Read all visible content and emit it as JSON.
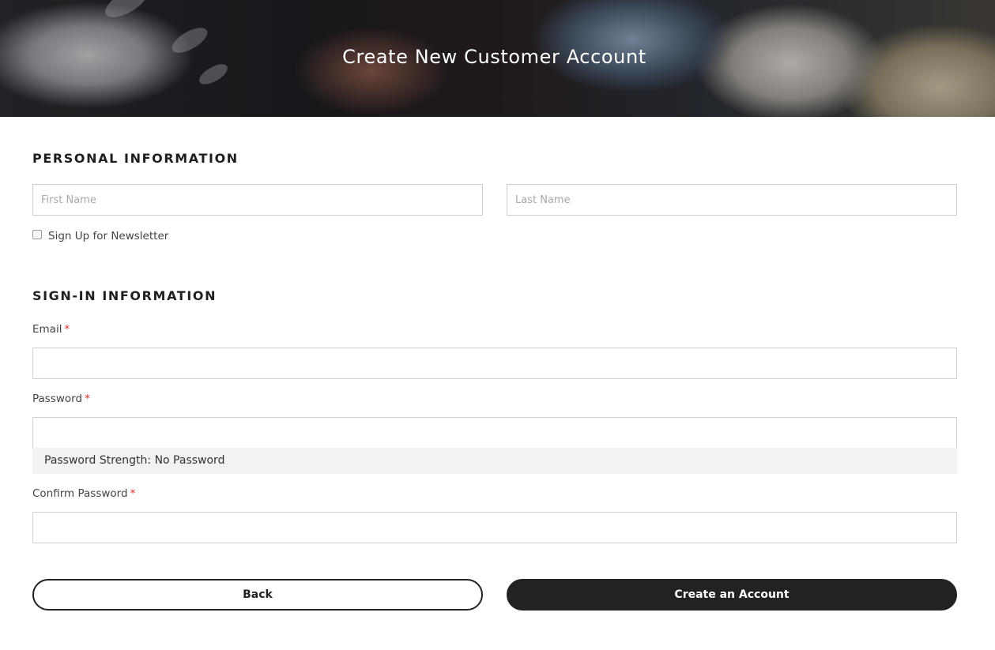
{
  "hero": {
    "title": "Create New Customer Account"
  },
  "personal": {
    "heading": "PERSONAL INFORMATION",
    "first_name_placeholder": "First Name",
    "last_name_placeholder": "Last Name",
    "newsletter_label": "Sign Up for Newsletter",
    "newsletter_checked": false
  },
  "signin": {
    "heading": "SIGN-IN INFORMATION",
    "email_label": "Email",
    "password_label": "Password",
    "password_strength": "Password Strength: No Password",
    "confirm_label": "Confirm Password",
    "required_marker": "*"
  },
  "actions": {
    "back_label": "Back",
    "create_label": "Create an Account"
  },
  "colors": {
    "required": "#e02b27",
    "button_dark": "#222222",
    "input_border": "#cfcfcf"
  }
}
